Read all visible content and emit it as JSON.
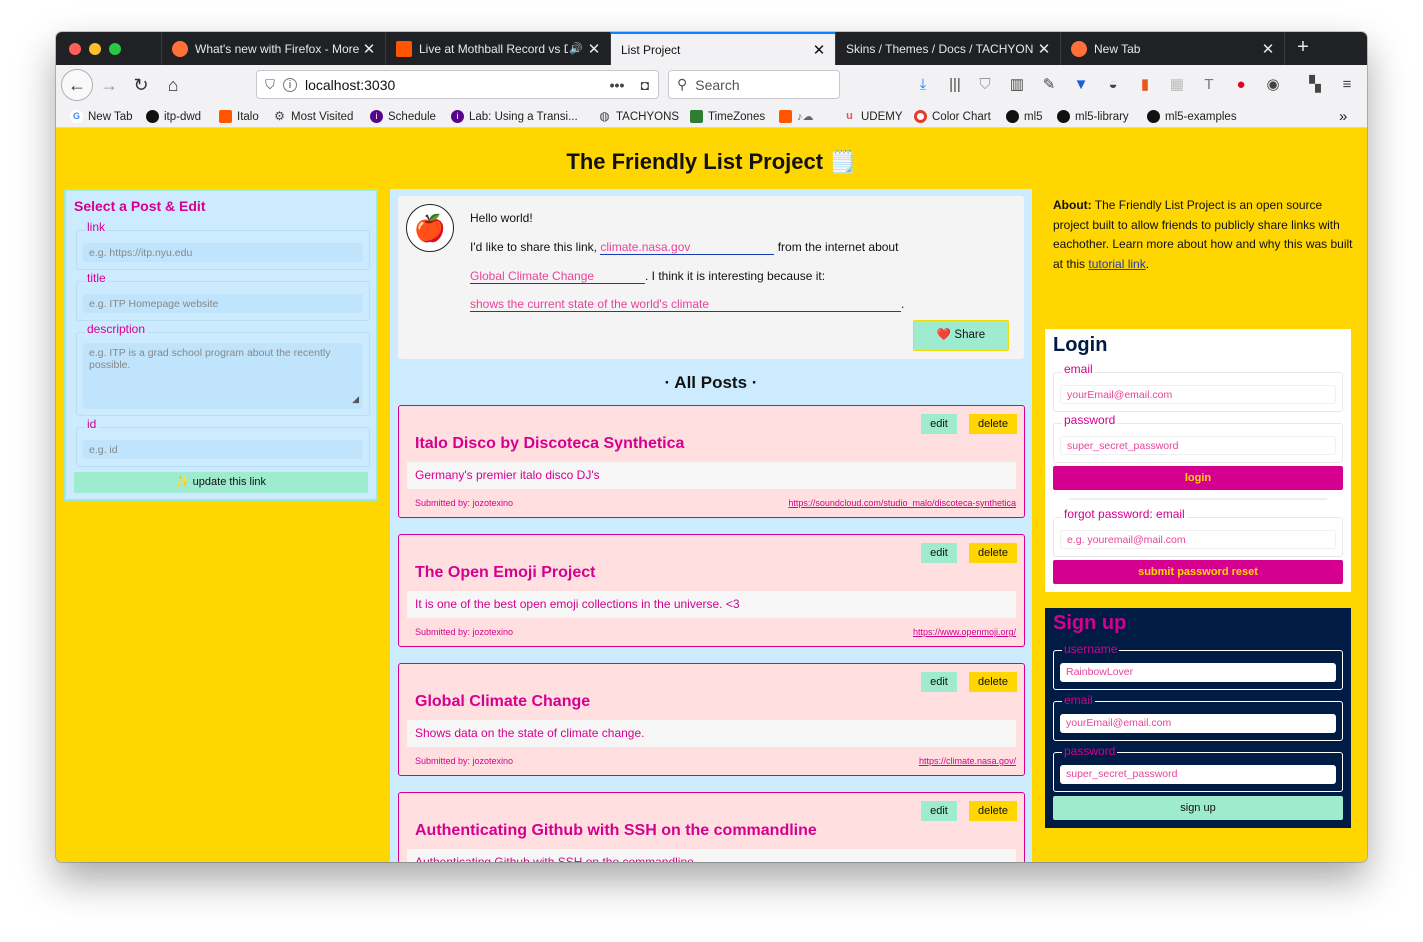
{
  "browser": {
    "tabs": [
      {
        "label": "What's new with Firefox - More",
        "favicon_color": "#ff7139"
      },
      {
        "label": "Live at Mothball Record vs D",
        "favicon_color": "#ff5500"
      },
      {
        "label": "List Project",
        "favicon_color": ""
      },
      {
        "label": "Skins / Themes / Docs / TACHYONS",
        "favicon_color": ""
      },
      {
        "label": "New Tab",
        "favicon_color": "#ff7139"
      }
    ],
    "url": "localhost:3030",
    "search_placeholder": "Search",
    "bookmarks": [
      {
        "label": "New Tab",
        "icon": "google-icon"
      },
      {
        "label": "itp-dwd",
        "icon": "github-icon"
      },
      {
        "label": "Italo",
        "icon": "soundcloud-icon"
      },
      {
        "label": "Most Visited",
        "icon": "gear-icon"
      },
      {
        "label": "Schedule",
        "icon": "itp-icon"
      },
      {
        "label": "Lab: Using a Transi...",
        "icon": "itp-icon"
      },
      {
        "label": "TACHYONS",
        "icon": "globe-icon"
      },
      {
        "label": "TimeZones",
        "icon": "timezones-icon"
      },
      {
        "label": "",
        "icon": "soundcloud-icon"
      },
      {
        "label": "UDEMY",
        "icon": "udemy-icon"
      },
      {
        "label": "Color Chart",
        "icon": "color-chart-icon"
      },
      {
        "label": "ml5",
        "icon": "github-icon"
      },
      {
        "label": "ml5-library",
        "icon": "github-icon"
      },
      {
        "label": "ml5-examples",
        "icon": "github-icon"
      }
    ]
  },
  "page": {
    "title": "The Friendly List Project 🗒️"
  },
  "edit_panel": {
    "title": "Select a Post & Edit",
    "fields": [
      {
        "label": "link",
        "placeholder": "e.g. https://itp.nyu.edu"
      },
      {
        "label": "title",
        "placeholder": "e.g. ITP Homepage website"
      },
      {
        "label": "description",
        "placeholder": "e.g. ITP is a grad school program about the recently possible."
      },
      {
        "label": "id",
        "placeholder": "e.g. id"
      }
    ],
    "update_button": "✨ update this link"
  },
  "compose": {
    "greeting": "Hello world!",
    "line1_prefix": "I'd like to share this link,",
    "link_value": "climate.nasa.gov",
    "line1_suffix": "from the internet about",
    "topic_value": "Global Climate Change",
    "line2_suffix": ". I think it is interesting because it:",
    "reason_value": "shows the current state of the world's climate",
    "share_button": "❤️ Share"
  },
  "posts_heading": "· All Posts ·",
  "posts": [
    {
      "title": "Italo Disco by Discoteca Synthetica",
      "description": "Germany's premier italo disco DJ's",
      "submitted": "Submitted by: jozotexino",
      "link": "https://soundcloud.com/studio_malo/discoteca-synthetica",
      "edit": "edit",
      "delete": "delete"
    },
    {
      "title": "The Open Emoji Project",
      "description": "It is one of the best open emoji collections in the universe. <3",
      "submitted": "Submitted by: jozotexino",
      "link": "https://www.openmoji.org/",
      "edit": "edit",
      "delete": "delete"
    },
    {
      "title": "Global Climate Change",
      "description": "Shows data on the state of climate change.",
      "submitted": "Submitted by: jozotexino",
      "link": "https://climate.nasa.gov/",
      "edit": "edit",
      "delete": "delete"
    },
    {
      "title": "Authenticating Github with SSH on the commandline",
      "description": "Authenticating Github with SSH on the commandline",
      "submitted": "",
      "link": "",
      "edit": "edit",
      "delete": "delete"
    }
  ],
  "about": {
    "label": "About:",
    "text": " The Friendly List Project is an open source project built to allow friends to publicly share links with eachother. Learn more about how and why this was built at this ",
    "link_text": "tutorial link",
    "end": "."
  },
  "login": {
    "title": "Login",
    "email_label": "email",
    "email_placeholder": "yourEmail@email.com",
    "password_label": "password",
    "password_placeholder": "super_secret_password",
    "login_button": "login",
    "forgot_label": "forgot password: email",
    "forgot_placeholder": "e.g. youremail@mail.com",
    "reset_button": "submit password reset"
  },
  "signup": {
    "title": "Sign up",
    "username_label": "username",
    "username_placeholder": "RainbowLover",
    "email_label": "email",
    "email_placeholder": "yourEmail@email.com",
    "password_label": "password",
    "password_placeholder": "super_secret_password",
    "button": "sign up"
  },
  "colors": {
    "page_bg": "#ffd600",
    "accent": "#d5008f",
    "panel_bg": "#ccebff",
    "mint": "#9eebcf",
    "navy": "#001b44",
    "post_bg": "#ffdfdf"
  }
}
